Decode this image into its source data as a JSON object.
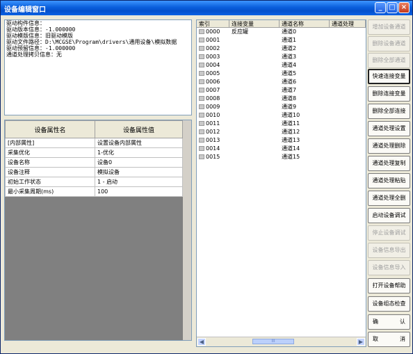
{
  "window": {
    "title": "设备编辑窗口",
    "buttons": [
      "minimize-icon",
      "maximize-icon",
      "close-icon"
    ]
  },
  "info_lines": [
    "驱动构件信息：",
    "驱动版本信息：-1.000000",
    "驱动模版信息：旧驱动模版",
    "驱动文件路径：D:\\MCGSE\\Program\\drivers\\通用设备\\模拟数据",
    "驱动预留信息：-1.000000",
    "通道处理拷贝信息：无"
  ],
  "props": {
    "headers": [
      "设备属性名",
      "设备属性值"
    ],
    "rows": [
      [
        "[内部属性]",
        "设置设备内部属性"
      ],
      [
        "采集优化",
        "1-优化"
      ],
      [
        "设备名称",
        "设备0"
      ],
      [
        "设备注释",
        "模拟设备"
      ],
      [
        "初始工作状态",
        "1 - 启动"
      ],
      [
        "最小采集周期(ms)",
        "100"
      ]
    ]
  },
  "grid": {
    "headers": [
      "索引",
      "连接变量",
      "通道名称",
      "通道处理"
    ],
    "rows": [
      [
        "0000",
        "反应罐",
        "通道0",
        ""
      ],
      [
        "0001",
        "",
        "通道1",
        ""
      ],
      [
        "0002",
        "",
        "通道2",
        ""
      ],
      [
        "0003",
        "",
        "通道3",
        ""
      ],
      [
        "0004",
        "",
        "通道4",
        ""
      ],
      [
        "0005",
        "",
        "通道5",
        ""
      ],
      [
        "0006",
        "",
        "通道6",
        ""
      ],
      [
        "0007",
        "",
        "通道7",
        ""
      ],
      [
        "0008",
        "",
        "通道8",
        ""
      ],
      [
        "0009",
        "",
        "通道9",
        ""
      ],
      [
        "0010",
        "",
        "通道10",
        ""
      ],
      [
        "0011",
        "",
        "通道11",
        ""
      ],
      [
        "0012",
        "",
        "通道12",
        ""
      ],
      [
        "0013",
        "",
        "通道13",
        ""
      ],
      [
        "0014",
        "",
        "通道14",
        ""
      ],
      [
        "0015",
        "",
        "通道15",
        ""
      ]
    ],
    "hscroll": {
      "left_icon": "arrow-left-icon",
      "right_icon": "arrow-right-icon",
      "thumb_glyph": "III"
    }
  },
  "buttons": [
    {
      "label": "增加设备通道",
      "enabled": false
    },
    {
      "label": "删除设备通道",
      "enabled": false
    },
    {
      "label": "删除全部通道",
      "enabled": false
    },
    {
      "label": "快速连接变量",
      "enabled": true,
      "selected": true
    },
    {
      "label": "删除连接变量",
      "enabled": true
    },
    {
      "label": "删除全部连接",
      "enabled": true
    },
    {
      "label": "通道处理设置",
      "enabled": true
    },
    {
      "label": "通道处理删除",
      "enabled": true
    },
    {
      "label": "通道处理复制",
      "enabled": true
    },
    {
      "label": "通道处理粘贴",
      "enabled": true
    },
    {
      "label": "通道处理全删",
      "enabled": true
    },
    {
      "label": "启动设备调试",
      "enabled": true
    },
    {
      "label": "停止设备调试",
      "enabled": false
    },
    {
      "label": "设备信息导出",
      "enabled": false
    },
    {
      "label": "设备信息导入",
      "enabled": false
    },
    {
      "label": "打开设备帮助",
      "enabled": true
    },
    {
      "label": "设备组态检查",
      "enabled": true
    },
    {
      "label": "确 认",
      "enabled": true,
      "spaced": true
    },
    {
      "label": "取 消",
      "enabled": true,
      "spaced": true
    }
  ]
}
